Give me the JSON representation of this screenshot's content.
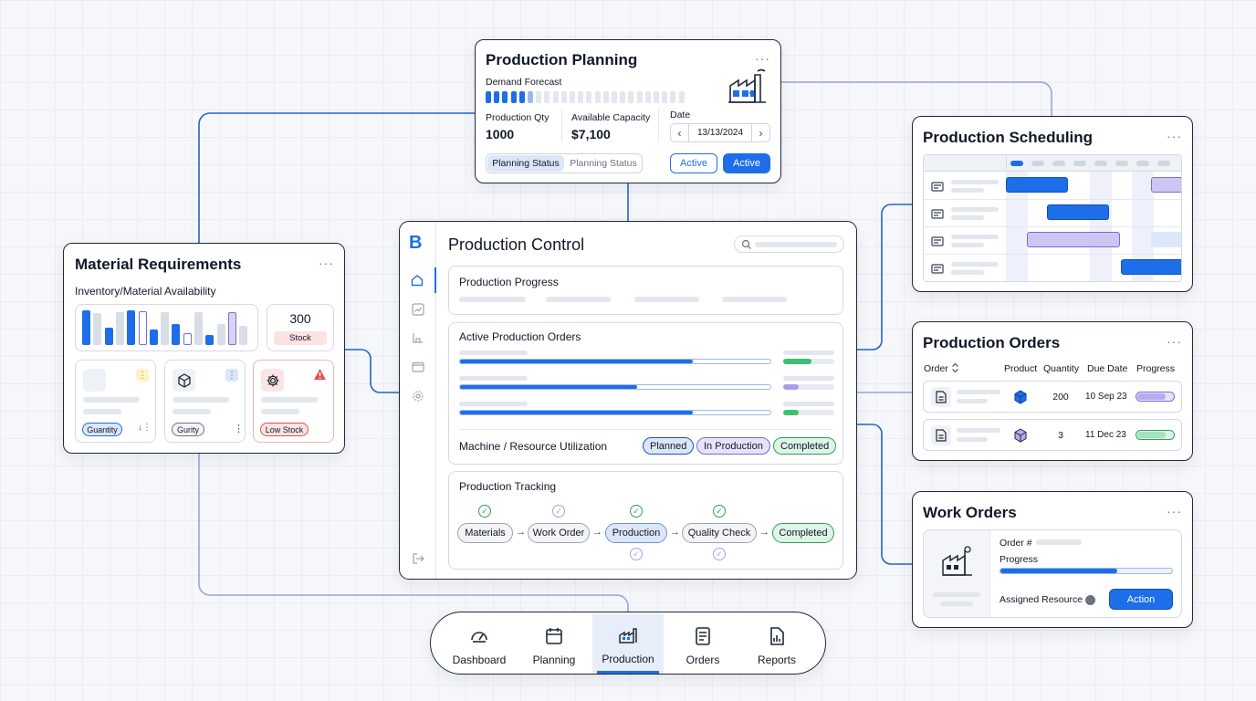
{
  "planning": {
    "title": "Production Planning",
    "demand_label": "Demand Forecast",
    "qty_label": "Production Qty",
    "qty_value": "1000",
    "capacity_label": "Available Capacity",
    "capacity_value": "$7,100",
    "date_label": "Date",
    "date_value": "13/13/2024",
    "seg_active": "Planning Status",
    "seg_inactive": "Planning Status",
    "btn_outline": "Active",
    "btn_solid": "Active",
    "more": "···"
  },
  "material": {
    "title": "Material Requirements",
    "subtitle": "Inventory/Material Availability",
    "stock_value": "300",
    "stock_label": "Stock",
    "tag1": "Guantity",
    "tag2": "Gurity",
    "tag3": "Low Stock",
    "more": "···"
  },
  "control": {
    "title": "Production Control",
    "logo": "B",
    "progress_title": "Production Progress",
    "orders_title": "Active Production Orders",
    "util_title": "Machine / Resource Utilization",
    "status_chips": [
      "Planned",
      "In Production",
      "Completed"
    ],
    "tracking_title": "Production Tracking",
    "tracking_steps": [
      "Materials",
      "Work Order",
      "Production",
      "Quality Check",
      "Completed"
    ]
  },
  "scheduling": {
    "title": "Production Scheduling",
    "more": "···"
  },
  "orders": {
    "title": "Production Orders",
    "more": "···",
    "headers": [
      "Order",
      "Product",
      "Quantity",
      "Due Date",
      "Progress"
    ],
    "rows": [
      {
        "quantity": "200",
        "due": "10 Sep 23",
        "progress": 0.8
      },
      {
        "quantity": "3",
        "due": "11 Dec 23",
        "progress": 0.8
      }
    ]
  },
  "work": {
    "title": "Work Orders",
    "more": "···",
    "order_label": "Order #",
    "progress_label": "Progress",
    "progress": 0.68,
    "resource_label": "Assigned Resource",
    "action": "Action"
  },
  "nav": {
    "items": [
      "Dashboard",
      "Planning",
      "Production",
      "Orders",
      "Reports"
    ],
    "active": "Production"
  },
  "colors": {
    "accent": "#1d6ee8",
    "purple": "#a99de8",
    "green": "#3fbf72",
    "red": "#e35151"
  }
}
